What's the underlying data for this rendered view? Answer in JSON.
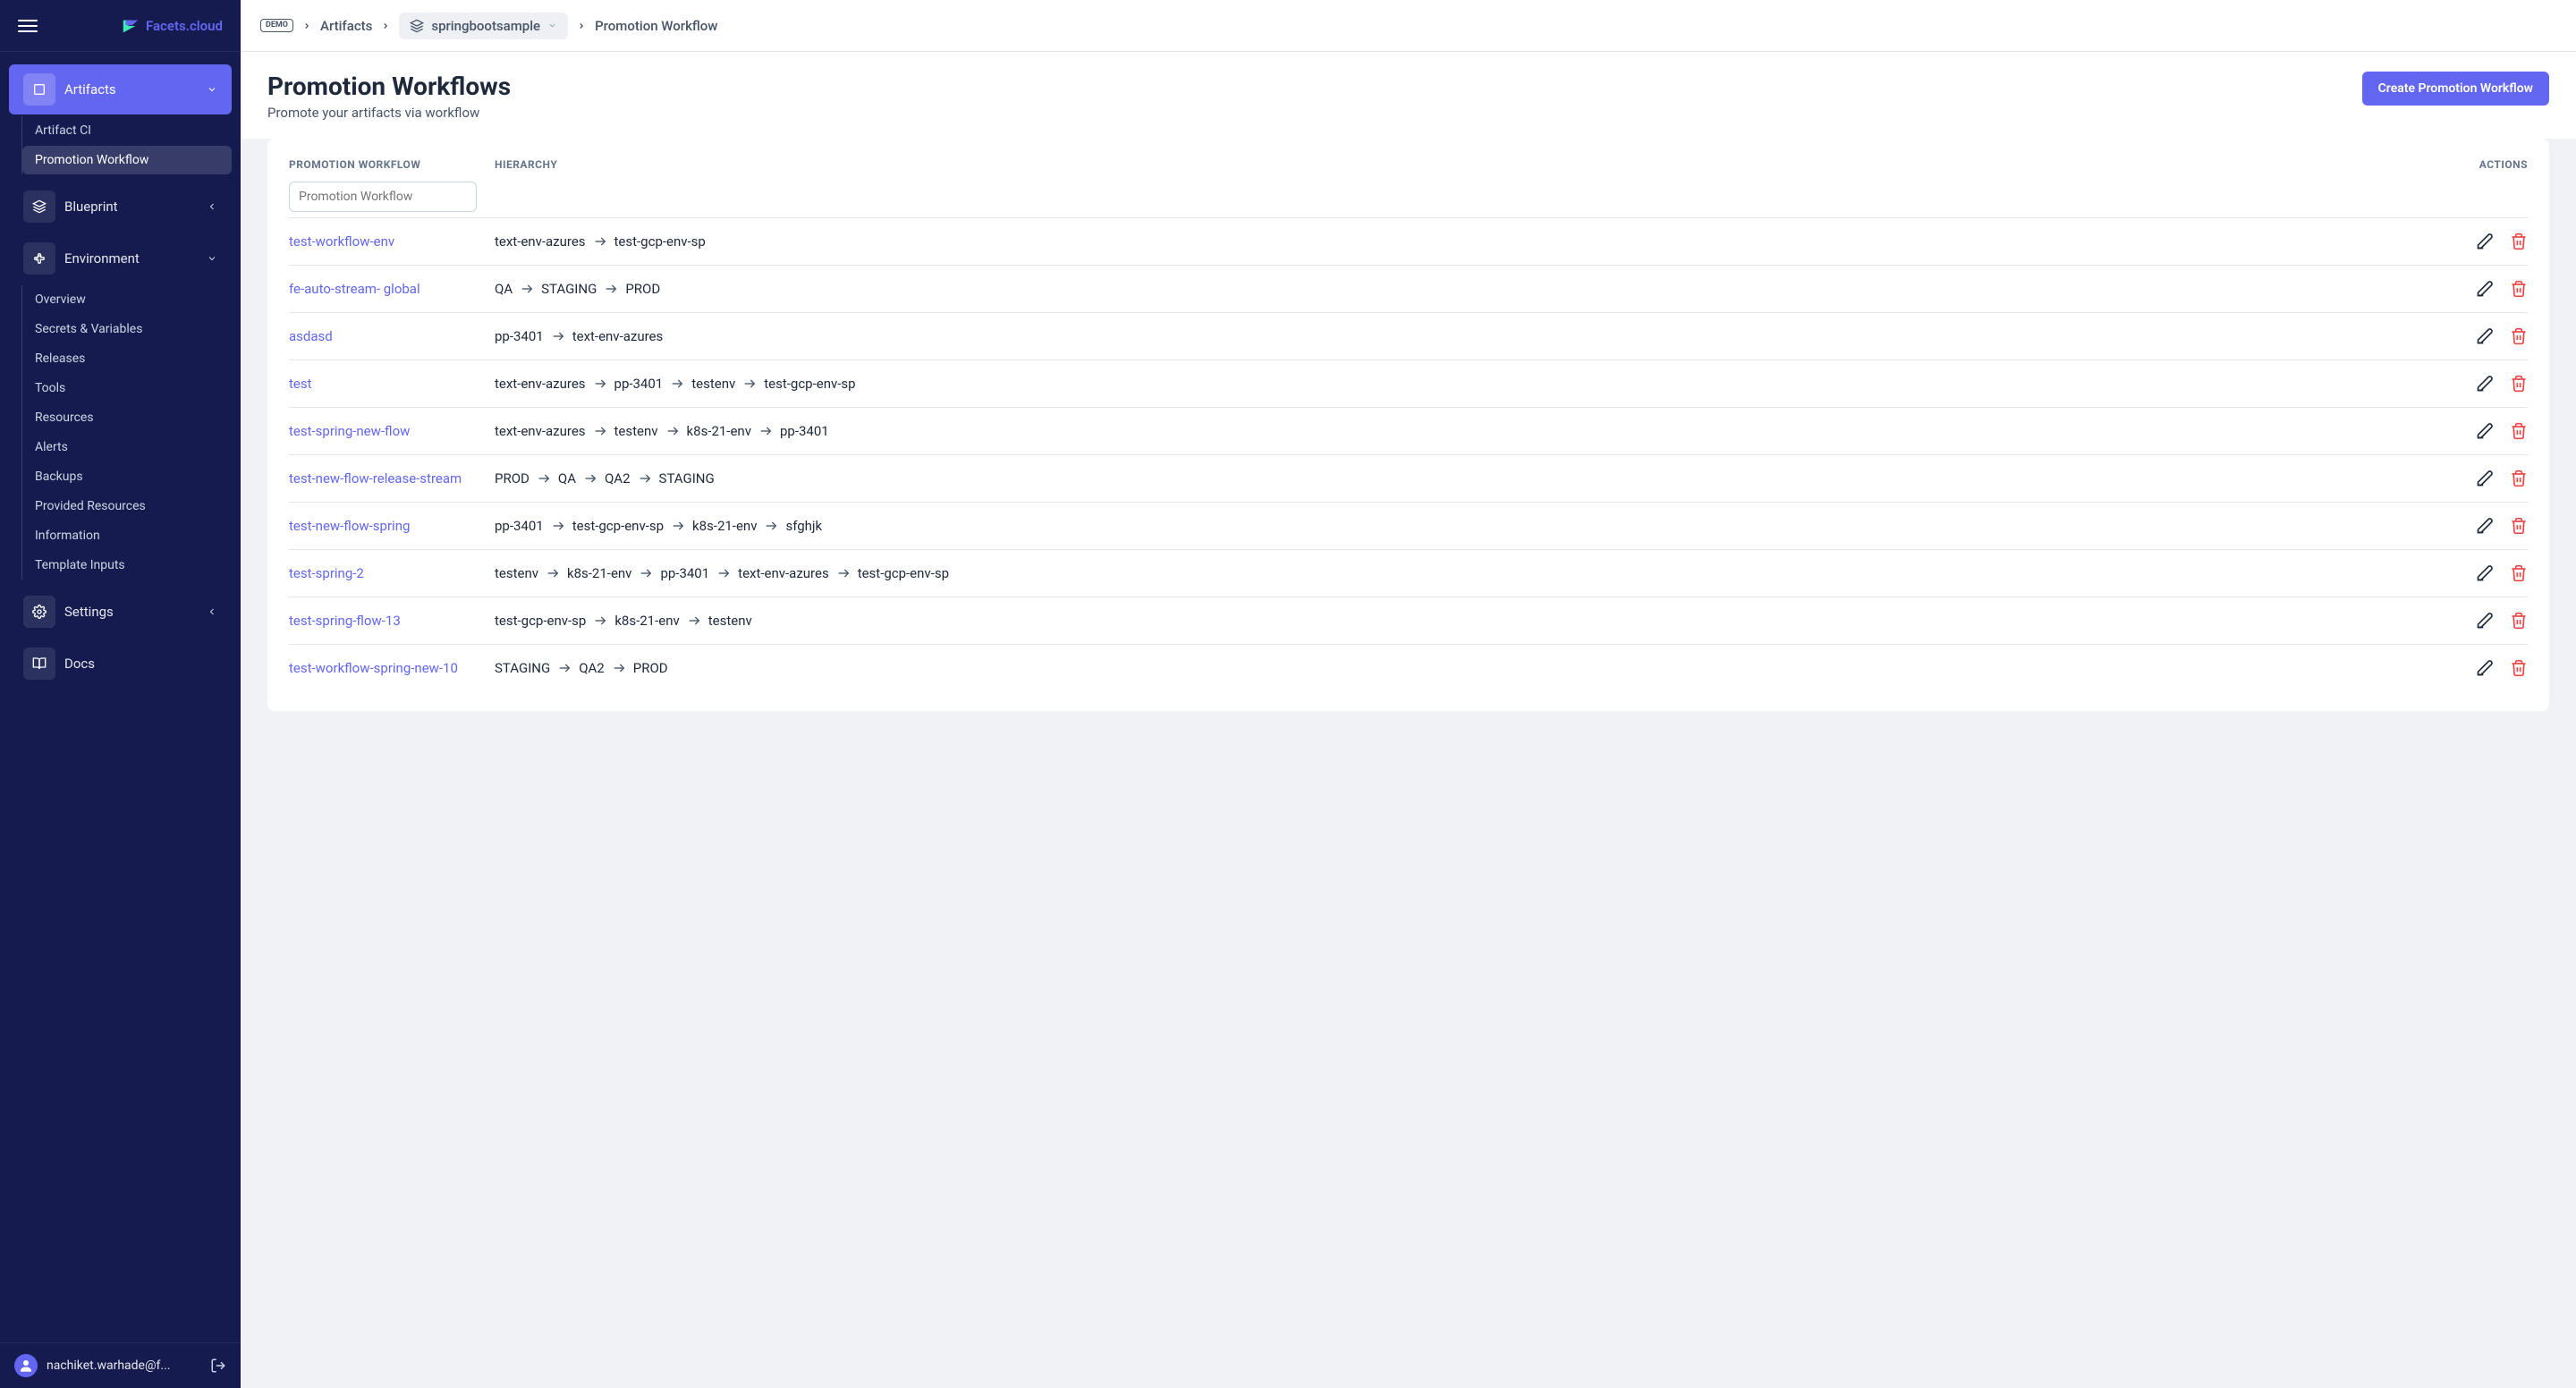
{
  "brand": "Facets.cloud",
  "sidebar": {
    "artifacts_label": "Artifacts",
    "artifact_ci_label": "Artifact CI",
    "promotion_workflow_label": "Promotion Workflow",
    "blueprint_label": "Blueprint",
    "environment_label": "Environment",
    "env_items": {
      "overview": "Overview",
      "secrets": "Secrets & Variables",
      "releases": "Releases",
      "tools": "Tools",
      "resources": "Resources",
      "alerts": "Alerts",
      "backups": "Backups",
      "provided": "Provided Resources",
      "information": "Information",
      "template": "Template Inputs"
    },
    "settings_label": "Settings",
    "docs_label": "Docs"
  },
  "user_email": "nachiket.warhade@f...",
  "breadcrumb": {
    "demo": "DEMO",
    "artifacts": "Artifacts",
    "sample": "springbootsample",
    "current": "Promotion Workflow"
  },
  "page": {
    "title": "Promotion Workflows",
    "subtitle": "Promote your artifacts via workflow",
    "create_btn": "Create Promotion Workflow"
  },
  "table": {
    "th_workflow": "PROMOTION WORKFLOW",
    "th_hierarchy": "HIERARCHY",
    "th_actions": "ACTIONS",
    "filter_placeholder": "Promotion Workflow",
    "rows": [
      {
        "name": "test-workflow-env",
        "hierarchy": [
          "text-env-azures",
          "test-gcp-env-sp"
        ]
      },
      {
        "name": "fe-auto-stream- global",
        "hierarchy": [
          "QA",
          "STAGING",
          "PROD"
        ]
      },
      {
        "name": "asdasd",
        "hierarchy": [
          "pp-3401",
          "text-env-azures"
        ]
      },
      {
        "name": "test",
        "hierarchy": [
          "text-env-azures",
          "pp-3401",
          "testenv",
          "test-gcp-env-sp"
        ]
      },
      {
        "name": "test-spring-new-flow",
        "hierarchy": [
          "text-env-azures",
          "testenv",
          "k8s-21-env",
          "pp-3401"
        ]
      },
      {
        "name": "test-new-flow-release-stream",
        "hierarchy": [
          "PROD",
          "QA",
          "QA2",
          "STAGING"
        ]
      },
      {
        "name": "test-new-flow-spring",
        "hierarchy": [
          "pp-3401",
          "test-gcp-env-sp",
          "k8s-21-env",
          "sfghjk"
        ]
      },
      {
        "name": "test-spring-2",
        "hierarchy": [
          "testenv",
          "k8s-21-env",
          "pp-3401",
          "text-env-azures",
          "test-gcp-env-sp"
        ]
      },
      {
        "name": "test-spring-flow-13",
        "hierarchy": [
          "test-gcp-env-sp",
          "k8s-21-env",
          "testenv"
        ]
      },
      {
        "name": "test-workflow-spring-new-10",
        "hierarchy": [
          "STAGING",
          "QA2",
          "PROD"
        ]
      }
    ]
  }
}
